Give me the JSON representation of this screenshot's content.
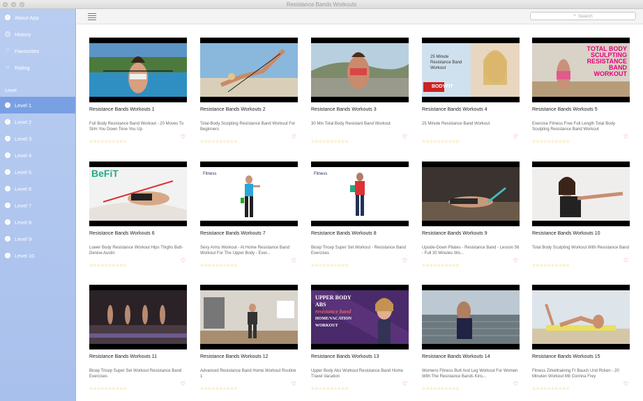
{
  "window": {
    "title": "Resistance Bands Workouts"
  },
  "sidebar": {
    "items": [
      {
        "label": "About App",
        "icon": "info-icon"
      },
      {
        "label": "History",
        "icon": "clock-icon"
      },
      {
        "label": "Favourites",
        "icon": "heart-icon"
      },
      {
        "label": "Rating",
        "icon": "star-icon"
      }
    ],
    "section_label": "Level",
    "levels": [
      "Level 1",
      "Level 2",
      "Level 3",
      "Level 4",
      "Level 5",
      "Level 6",
      "Level 7",
      "Level 8",
      "Level 9",
      "Level 10"
    ],
    "active_level": "Level 1"
  },
  "toolbar": {
    "search_placeholder": "Search",
    "menu_icon": "list-icon"
  },
  "stars": "☆☆☆☆☆☆☆☆☆☆",
  "videos": [
    {
      "title": "Resistance Bands Workouts 1",
      "desc": "Full Body Resistance Band Workout - 20 Moves To Slim You Down  Tone You Up"
    },
    {
      "title": "Resistance Bands Workouts 2",
      "desc": "Total-Body Sculpting Resistance Band Workout For Beginners"
    },
    {
      "title": "Resistance Bands Workouts 3",
      "desc": "30 Min Total Body Resistant Band Workout"
    },
    {
      "title": "Resistance Bands Workouts 4",
      "desc": "25 Minute Resistance Band Workout"
    },
    {
      "title": "Resistance Bands Workouts 5",
      "desc": "Exercise Fitness Free Full Length Total Body Sculpting Resistance Band Workout"
    },
    {
      "title": "Resistance Bands Workouts 6",
      "desc": "Lower Body Resistance Workout Hips Thighs Butt- Denise Austin"
    },
    {
      "title": "Resistance Bands Workouts 7",
      "desc": "Sexy Arms Workout - At Home Resistance Band Workout For The Upper Body - Exer..."
    },
    {
      "title": "Resistance Bands Workouts 8",
      "desc": "Bicep Tricep Super Set Workout - Resistance Band Exercises"
    },
    {
      "title": "Resistance Bands Workouts 9",
      "desc": "Upside-Down Pilates - Resistance Band - Lesson 56 - Full 30 Minutes Wo..."
    },
    {
      "title": "Resistance Bands Workouts 10",
      "desc": "Total Body Sculpting Workout With Resistance Band"
    },
    {
      "title": "Resistance Bands Workouts 11",
      "desc": "Bicep Tricep Super Set Workout Resistance Band Exercises"
    },
    {
      "title": "Resistance Bands Workouts 12",
      "desc": "Advanced Resistance Band Home Workout Routine 1"
    },
    {
      "title": "Resistance Bands Workouts 13",
      "desc": "Upper Body  Abs Workout  Resistance Band Home Travel Vacation"
    },
    {
      "title": "Resistance Bands Workouts 14",
      "desc": "Womens Fitness Butt And Leg Workout For Women With The Resistance Bands  Kins..."
    },
    {
      "title": "Resistance Bands Workouts 15",
      "desc": "Fitness Zirkeltraining Fr Bauch Und Rcken - 20 Minuten Workout Mit Corinna Frey"
    }
  ],
  "thumb_text": {
    "t4": [
      "25 Minute",
      "Resistance Band",
      "Workout",
      "BODYFIT"
    ],
    "t5": [
      "TOTAL BODY",
      "SCULPTING",
      "RESISTANCE",
      "BAND",
      "WORKOUT"
    ],
    "t6": "BeFiT",
    "t7": "Fitness",
    "t8": "Fitness",
    "t13": [
      "UPPER BODY",
      "ABS",
      "resistance band",
      "HOME/VACATION",
      "WORKOUT"
    ]
  },
  "colors": {
    "sidebar": "#a8c0ec",
    "active": "#7aa0e4",
    "star": "#e6b632",
    "heart": "#e05a6a"
  }
}
